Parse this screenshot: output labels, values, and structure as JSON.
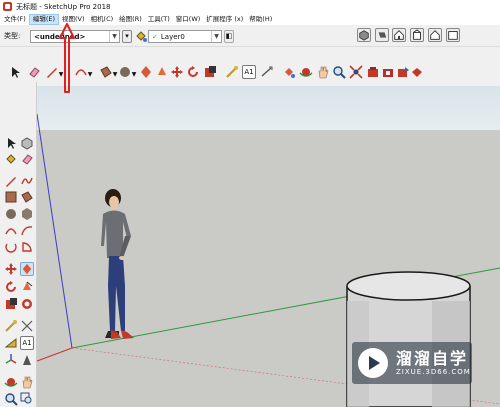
{
  "window": {
    "title": "无标题 - SketchUp Pro 2018"
  },
  "menubar": {
    "items": [
      {
        "label": "文件(F)",
        "active": false
      },
      {
        "label": "编辑(E)",
        "active": true
      },
      {
        "label": "视图(V)",
        "active": false
      },
      {
        "label": "相机(C)",
        "active": false
      },
      {
        "label": "绘图(R)",
        "active": false
      },
      {
        "label": "工具(T)",
        "active": false
      },
      {
        "label": "窗口(W)",
        "active": false
      },
      {
        "label": "扩展程序 (x)",
        "active": false
      },
      {
        "label": "帮助(H)",
        "active": false
      }
    ]
  },
  "entity_toolbar": {
    "type_label": "类型:",
    "type_value": "<undefined>",
    "layer_value": "Layer0"
  },
  "colors": {
    "accent_menu": "#cce4f7",
    "red_axis": "#d12a2a",
    "green_axis": "#2e9a3a",
    "blue_axis": "#3c3cc8",
    "annotation_arrow": "#e02020"
  },
  "watermark": {
    "main_text": "溜溜自学",
    "sub_text": "ZIXUE.3D66.COM"
  }
}
